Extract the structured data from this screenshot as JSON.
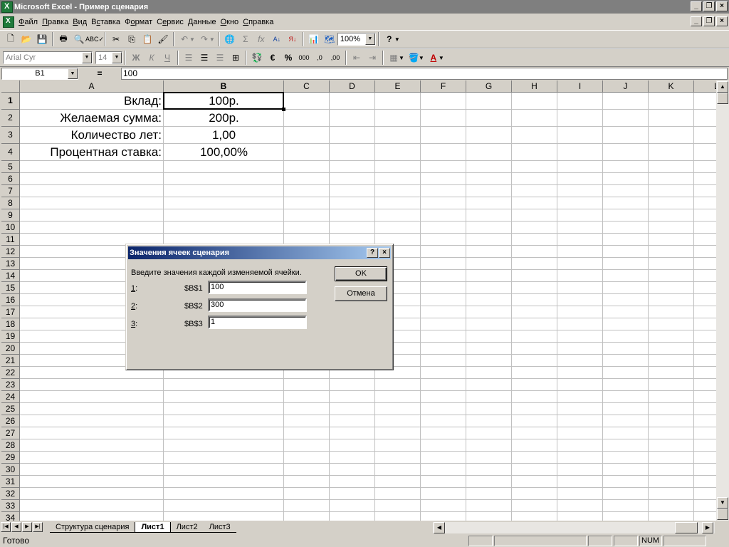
{
  "window": {
    "title": "Microsoft Excel - Пример сценария"
  },
  "menu": [
    {
      "label": "Файл",
      "key": "Ф"
    },
    {
      "label": "Правка",
      "key": "П"
    },
    {
      "label": "Вид",
      "key": "В"
    },
    {
      "label": "Вставка",
      "key": "с"
    },
    {
      "label": "Формат",
      "key": "о"
    },
    {
      "label": "Сервис",
      "key": "е"
    },
    {
      "label": "Данные",
      "key": "Д"
    },
    {
      "label": "Окно",
      "key": "О"
    },
    {
      "label": "Справка",
      "key": "С"
    }
  ],
  "toolbar": {
    "zoom": "100%",
    "font": "Arial Cyr",
    "size": "14"
  },
  "formula_bar": {
    "name_box": "B1",
    "equals": "=",
    "value": "100"
  },
  "columns": [
    "A",
    "B",
    "C",
    "D",
    "E",
    "F",
    "G",
    "H",
    "I",
    "J",
    "K",
    "L"
  ],
  "rows": [
    "1",
    "2",
    "3",
    "4",
    "5",
    "6",
    "7",
    "8",
    "9",
    "10",
    "11",
    "12",
    "13",
    "14",
    "15",
    "16",
    "17",
    "18",
    "19",
    "20",
    "21",
    "22",
    "23",
    "24",
    "25",
    "26",
    "27",
    "28",
    "29",
    "30",
    "31",
    "32",
    "33",
    "34"
  ],
  "cells": {
    "A1": "Вклад:",
    "B1": "100р.",
    "A2": "Желаемая сумма:",
    "B2": "200р.",
    "A3": "Количество лет:",
    "B3": "1,00",
    "A4": "Процентная ставка:",
    "B4": "100,00%"
  },
  "dialog": {
    "title": "Значения ячеек сценария",
    "help": "?",
    "close": "×",
    "instruction": "Введите значения каждой изменяемой ячейки.",
    "fields": [
      {
        "num": "1",
        "ref": "$B$1",
        "value": "100"
      },
      {
        "num": "2",
        "ref": "$B$2",
        "value": "300"
      },
      {
        "num": "3",
        "ref": "$B$3",
        "value": "1"
      }
    ],
    "ok": "OK",
    "cancel": "Отмена"
  },
  "tabs": [
    "Структура сценария",
    "Лист1",
    "Лист2",
    "Лист3"
  ],
  "active_tab": "Лист1",
  "status": {
    "text": "Готово",
    "num": "NUM"
  },
  "icons": [
    "new-icon",
    "open-icon",
    "save-icon",
    "print-icon",
    "preview-icon",
    "spell-icon",
    "cut-icon",
    "copy-icon",
    "paste-icon",
    "format-painter-icon",
    "undo-icon",
    "redo-icon",
    "hyperlink-icon",
    "autosum-icon",
    "function-icon",
    "sort-asc-icon",
    "sort-desc-icon",
    "chart-icon",
    "map-icon",
    "help-icon"
  ]
}
